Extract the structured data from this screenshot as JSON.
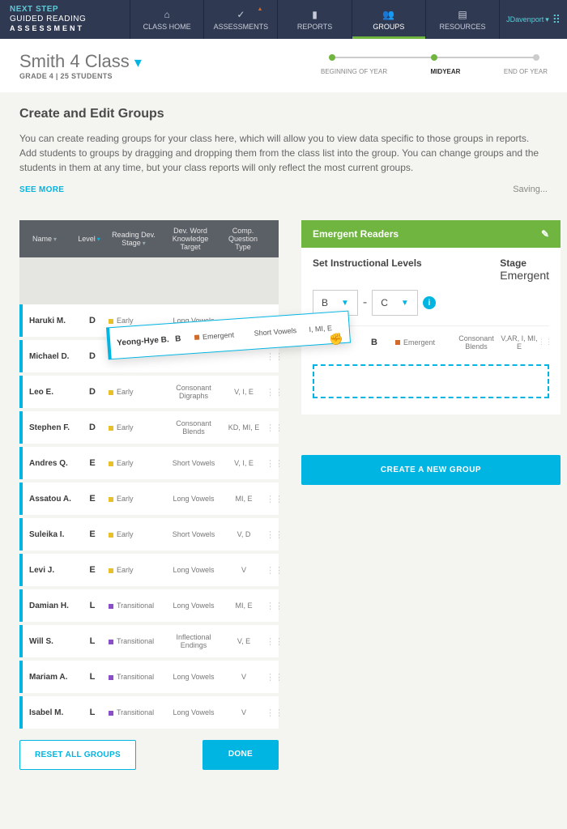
{
  "logo": {
    "l1": "NEXT STEP",
    "l2": "GUIDED READING",
    "l3": "ASSESSMENT"
  },
  "nav": [
    {
      "icon": "⌂",
      "label": "CLASS HOME"
    },
    {
      "icon": "✓",
      "label": "ASSESSMENTS",
      "badge": "▲"
    },
    {
      "icon": "▮",
      "label": "REPORTS"
    },
    {
      "icon": "👥",
      "label": "GROUPS",
      "active": true
    },
    {
      "icon": "▤",
      "label": "RESOURCES"
    }
  ],
  "user": {
    "name": "JDavenport"
  },
  "class": {
    "title": "Smith 4 Class",
    "sub": "GRADE 4 | 25 STUDENTS"
  },
  "timeline": {
    "l1": "BEGINNING OF YEAR",
    "l2": "MIDYEAR",
    "l3": "END OF YEAR"
  },
  "page": {
    "h2": "Create and Edit Groups",
    "intro": "You can create reading groups for your class here, which will allow you to view data specific to those groups in reports. Add students to groups by dragging and dropping them from the class list into the group. You can change groups and the students in them at any time, but your class reports will only reflect the most current groups.",
    "seemore": "SEE MORE",
    "saving": "Saving..."
  },
  "columns": {
    "name": "Name",
    "level": "Level",
    "stage": "Reading Dev. Stage",
    "wkt": "Dev. Word Knowledge Target",
    "cqt": "Comp. Question Type"
  },
  "students": [
    {
      "name": "Haruki M.",
      "level": "D",
      "stage": "Early",
      "dot": "yellow",
      "wkt": "Long Vowels",
      "cqt": ""
    },
    {
      "name": "Michael D.",
      "level": "D",
      "stage": "",
      "dot": "",
      "wkt": "",
      "cqt": ""
    },
    {
      "name": "Leo E.",
      "level": "D",
      "stage": "Early",
      "dot": "yellow",
      "wkt": "Consonant Digraphs",
      "cqt": "V, I, E"
    },
    {
      "name": "Stephen F.",
      "level": "D",
      "stage": "Early",
      "dot": "yellow",
      "wkt": "Consonant Blends",
      "cqt": "KD, MI, E"
    },
    {
      "name": "Andres Q.",
      "level": "E",
      "stage": "Early",
      "dot": "yellow",
      "wkt": "Short Vowels",
      "cqt": "V, I, E"
    },
    {
      "name": "Assatou A.",
      "level": "E",
      "stage": "Early",
      "dot": "yellow",
      "wkt": "Long Vowels",
      "cqt": "MI, E"
    },
    {
      "name": "Suleika I.",
      "level": "E",
      "stage": "Early",
      "dot": "yellow",
      "wkt": "Short Vowels",
      "cqt": "V, D"
    },
    {
      "name": "Levi J.",
      "level": "E",
      "stage": "Early",
      "dot": "yellow",
      "wkt": "Long Vowels",
      "cqt": "V"
    },
    {
      "name": "Damian H.",
      "level": "L",
      "stage": "Transitional",
      "dot": "purple",
      "wkt": "Long Vowels",
      "cqt": "MI, E"
    },
    {
      "name": "Will S.",
      "level": "L",
      "stage": "Transitional",
      "dot": "purple",
      "wkt": "Inflectional Endings",
      "cqt": "V, E"
    },
    {
      "name": "Mariam A.",
      "level": "L",
      "stage": "Transitional",
      "dot": "purple",
      "wkt": "Long Vowels",
      "cqt": "V"
    },
    {
      "name": "Isabel M.",
      "level": "L",
      "stage": "Transitional",
      "dot": "purple",
      "wkt": "Long Vowels",
      "cqt": "V"
    }
  ],
  "dragging": {
    "name": "Yeong-Hye B.",
    "level": "B",
    "stage": "Emergent",
    "dot": "orange",
    "wkt": "Short Vowels",
    "cqt": "I, MI, E"
  },
  "buttons": {
    "reset": "RESET ALL GROUPS",
    "done": "DONE"
  },
  "group": {
    "name": "Emergent Readers",
    "sil": "Set Instructional Levels",
    "stage_label": "Stage",
    "stage_value": "Emergent",
    "from": "B",
    "to": "C",
    "members": [
      {
        "name": "",
        "level": "B",
        "stage": "Emergent",
        "dot": "orange",
        "wkt": "Consonant Blends",
        "cqt": "V,AR, I, MI, E"
      }
    ],
    "create": "CREATE A NEW GROUP"
  }
}
